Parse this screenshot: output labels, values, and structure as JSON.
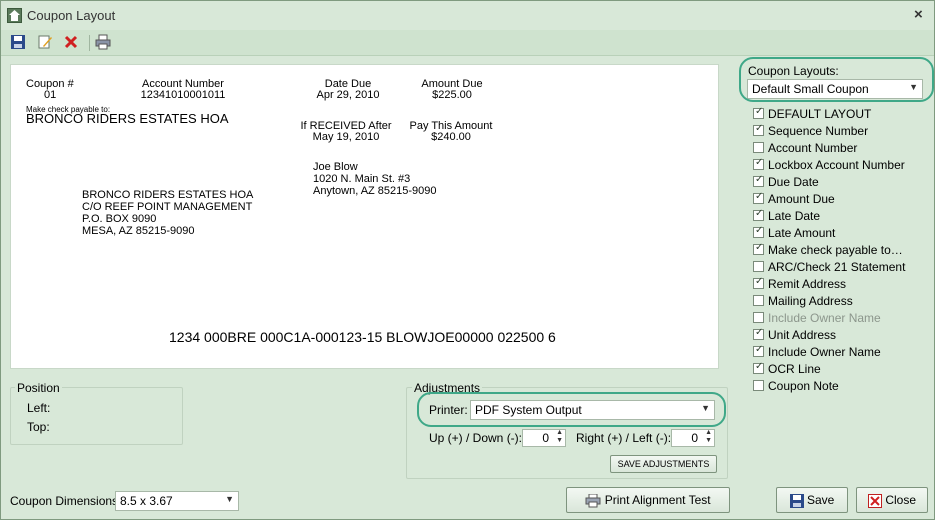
{
  "window": {
    "title": "Coupon Layout",
    "close_glyph": "×"
  },
  "toolbar": {
    "icons": [
      "save-icon",
      "edit-icon",
      "delete-icon",
      "print-icon"
    ]
  },
  "coupon": {
    "coupon_num_label": "Coupon #",
    "coupon_num": "01",
    "account_label": "Account Number",
    "account": "12341010001011",
    "date_due_label": "Date Due",
    "date_due": "Apr 29, 2010",
    "amount_due_label": "Amount Due",
    "amount_due": "$225.00",
    "payable_label": "Make check payable to:",
    "payable_to": "BRONCO RIDERS ESTATES HOA",
    "received_after_label": "If RECEIVED After",
    "received_after": "May 19, 2010",
    "pay_amount_label": "Pay This Amount",
    "pay_amount": "$240.00",
    "owner": [
      "Joe Blow",
      "1020 N. Main St. #3",
      "Anytown, AZ  85215-9090"
    ],
    "remit": [
      "BRONCO RIDERS ESTATES HOA",
      "C/O REEF POINT MANAGEMENT",
      "P.O. BOX 9090",
      "MESA, AZ  85215-9090"
    ],
    "ocr_line": "1234 000BRE 000C1A-000123-15 BLOWJOE00000 022500 6"
  },
  "position": {
    "title": "Position",
    "left_label": "Left:",
    "top_label": "Top:"
  },
  "adjustments": {
    "title": "Adjustments",
    "printer_label": "Printer:",
    "printer_value": "PDF System Output",
    "updown_label": "Up (+) / Down (-):",
    "updown_value": "0",
    "rightleft_label": "Right (+) / Left (-):",
    "rightleft_value": "0",
    "save_label": "SAVE  ADJUSTMENTS"
  },
  "dimensions": {
    "label": "Coupon Dimensions:",
    "value": "8.5 x 3.67"
  },
  "buttons": {
    "print_alignment": "Print Alignment Test",
    "save": "Save",
    "close": "Close"
  },
  "layouts": {
    "label": "Coupon Layouts:",
    "selected": "Default Small Coupon",
    "options": [
      {
        "label": "DEFAULT LAYOUT",
        "checked": true,
        "disabled": false
      },
      {
        "label": "Sequence Number",
        "checked": true,
        "disabled": false
      },
      {
        "label": "Account Number",
        "checked": false,
        "disabled": false
      },
      {
        "label": "Lockbox Account Number",
        "checked": true,
        "disabled": false
      },
      {
        "label": "Due Date",
        "checked": true,
        "disabled": false
      },
      {
        "label": "Amount Due",
        "checked": true,
        "disabled": false
      },
      {
        "label": "Late Date",
        "checked": true,
        "disabled": false
      },
      {
        "label": "Late Amount",
        "checked": true,
        "disabled": false
      },
      {
        "label": "Make check payable to…",
        "checked": true,
        "disabled": false
      },
      {
        "label": "ARC/Check 21 Statement",
        "checked": false,
        "disabled": false
      },
      {
        "label": "Remit Address",
        "checked": true,
        "disabled": false
      },
      {
        "label": "Mailing Address",
        "checked": false,
        "disabled": false
      },
      {
        "label": "Include Owner Name",
        "checked": false,
        "disabled": true
      },
      {
        "label": "Unit Address",
        "checked": true,
        "disabled": false
      },
      {
        "label": "Include Owner Name",
        "checked": true,
        "disabled": false
      },
      {
        "label": "OCR Line",
        "checked": true,
        "disabled": false
      },
      {
        "label": "Coupon Note",
        "checked": false,
        "disabled": false
      }
    ]
  },
  "colors": {
    "highlight": "#3fa888",
    "window_bg": "#d8e8d8"
  }
}
